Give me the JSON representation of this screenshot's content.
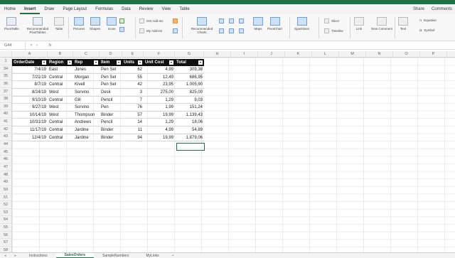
{
  "menu": {
    "tabs": [
      "Home",
      "Insert",
      "Draw",
      "Page Layout",
      "Formulas",
      "Data",
      "Review",
      "View",
      "Table"
    ],
    "active": "Insert",
    "share": "Share",
    "comments": "Comments"
  },
  "ribbon": {
    "pivottable": "PivotTable",
    "recommended_pivot": "Recommended PivotTables",
    "table": "Table",
    "pictures": "Pictures",
    "shapes": "Shapes",
    "icons": "Icons",
    "get_addins": "Get Add-ins",
    "my_addins": "My Add-ins",
    "recommended_charts": "Recommended Charts",
    "maps": "Maps",
    "pivotchart": "PivotChart",
    "sparklines": "Sparklines",
    "slicer": "Slicer",
    "timeline": "Timeline",
    "link": "Link",
    "new_comment": "New Comment",
    "text": "Text",
    "equation": "Equation",
    "symbol": "Symbol"
  },
  "formula_bar": {
    "name_box": "G44",
    "fx": "fx"
  },
  "columns": [
    "A",
    "B",
    "C",
    "D",
    "E",
    "F",
    "G",
    "H",
    "I",
    "J",
    "K",
    "L",
    "M",
    "N",
    "O",
    "P"
  ],
  "rows": [
    "1",
    "34",
    "35",
    "36",
    "37",
    "38",
    "39",
    "40",
    "41",
    "42",
    "43",
    "44",
    "45",
    "46",
    "47",
    "48",
    "49",
    "50",
    "51",
    "52",
    "53",
    "54",
    "55",
    "56",
    "57",
    "58"
  ],
  "table": {
    "headers": [
      "OrderDate",
      "Region",
      "Rep",
      "Item",
      "Units",
      "Unit Cost",
      "Total"
    ],
    "rows": [
      [
        "7/4/19",
        "East",
        "Jones",
        "Pen Set",
        "62",
        "4,99",
        "309,38"
      ],
      [
        "7/21/19",
        "Central",
        "Morgan",
        "Pen Set",
        "55",
        "12,49",
        "686,95"
      ],
      [
        "8/7/19",
        "Central",
        "Kivell",
        "Pen Set",
        "42",
        "23,95",
        "1.005,90"
      ],
      [
        "8/24/19",
        "West",
        "Sorvino",
        "Desk",
        "3",
        "275,00",
        "825,00"
      ],
      [
        "9/10/19",
        "Central",
        "Gill",
        "Pencil",
        "7",
        "1,29",
        "9,03"
      ],
      [
        "9/27/19",
        "West",
        "Sorvino",
        "Pen",
        "76",
        "1,99",
        "151,24"
      ],
      [
        "10/14/19",
        "West",
        "Thompson",
        "Binder",
        "57",
        "19,99",
        "1.139,43"
      ],
      [
        "10/31/19",
        "Central",
        "Andrews",
        "Pencil",
        "14",
        "1,29",
        "18,06"
      ],
      [
        "11/17/19",
        "Central",
        "Jardine",
        "Binder",
        "11",
        "4,99",
        "54,89"
      ],
      [
        "12/4/19",
        "Central",
        "Jardine",
        "Binder",
        "94",
        "19,99",
        "1.879,06"
      ]
    ]
  },
  "sheets": [
    "Instructions",
    "SalesOrders",
    "SampleNumbers",
    "MyLinks"
  ],
  "active_sheet": "SalesOrders",
  "colors": {
    "excel_green": "#1e7145",
    "header_black": "#111111"
  }
}
